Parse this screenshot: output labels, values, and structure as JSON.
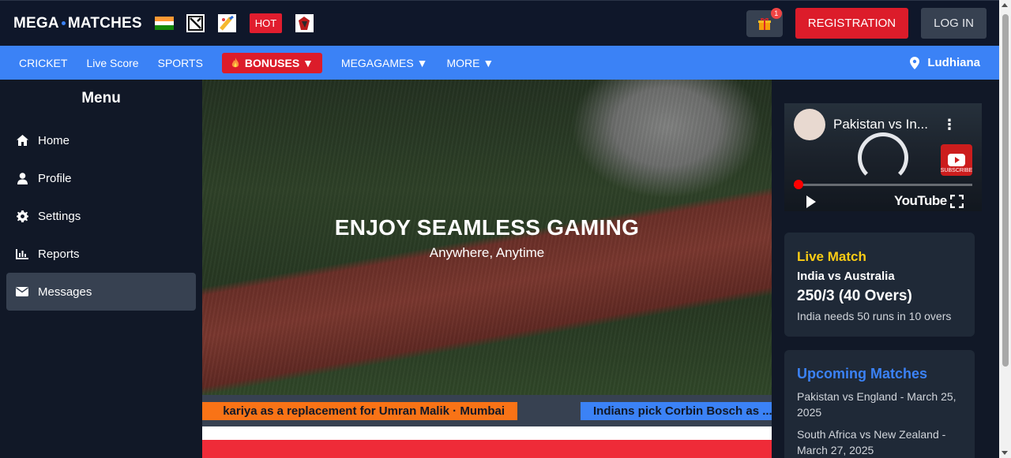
{
  "header": {
    "logo_left": "MEGA",
    "logo_right": "MATCHES",
    "hot_label": "HOT",
    "gift_badge": "1",
    "register_label": "REGISTRATION",
    "login_label": "LOG IN"
  },
  "nav": {
    "items": [
      "CRICKET",
      "Live Score",
      "SPORTS"
    ],
    "bonuses_label": "BONUSES ▼",
    "megagames_label": "MEGAGAMES ▼",
    "more_label": "MORE ▼",
    "location": "Ludhiana"
  },
  "sidebar": {
    "title": "Menu",
    "items": [
      {
        "label": "Home",
        "icon": "home-icon"
      },
      {
        "label": "Profile",
        "icon": "user-icon"
      },
      {
        "label": "Settings",
        "icon": "gear-icon"
      },
      {
        "label": "Reports",
        "icon": "bar-chart-icon"
      },
      {
        "label": "Messages",
        "icon": "envelope-icon",
        "active": true
      }
    ]
  },
  "hero": {
    "title": "ENJOY SEAMLESS GAMING",
    "subtitle": "Anywhere, Anytime"
  },
  "ticker": {
    "item1": "kariya as a replacement for Umran Malik · Mumbai",
    "item2": "Indians pick Corbin Bosch as ..."
  },
  "video": {
    "title": "Pakistan vs In...",
    "brand": "YouTube",
    "subscribe": "SUBSCRIBE"
  },
  "live_match": {
    "title": "Live Match",
    "teams": "India vs Australia",
    "score": "250/3 (40 Overs)",
    "note": "India needs 50 runs in 10 overs"
  },
  "upcoming": {
    "title": "Upcoming Matches",
    "items": [
      "Pakistan vs England - March 25, 2025",
      "South Africa vs New Zealand - March 27, 2025"
    ]
  },
  "colors": {
    "header_bg": "#0f172a",
    "nav_bg": "#3b82f6",
    "accent_red": "#dc1c2a",
    "live_title": "#facc15",
    "upcoming_title": "#3b82f6"
  }
}
